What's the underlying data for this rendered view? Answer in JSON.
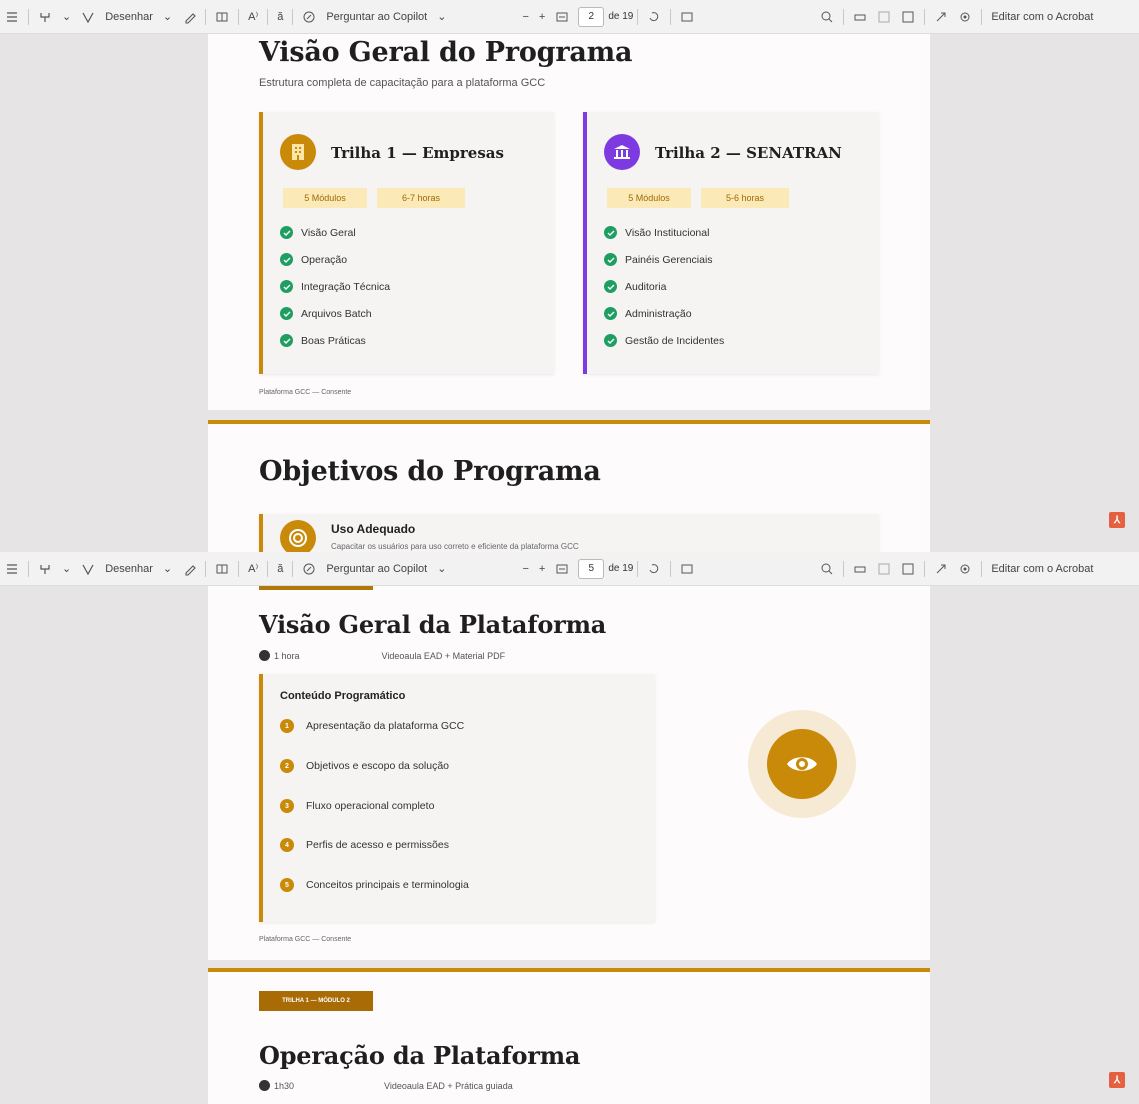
{
  "toolbar": {
    "draw_label": "Desenhar",
    "copilot_label": "Perguntar ao Copilot",
    "read_aloud": "A⁾",
    "translate": "ă",
    "minus": "−",
    "plus": "+",
    "edit_label": "Editar com o Acrobat"
  },
  "panes": [
    {
      "page_number": "2",
      "page_total": "de 19",
      "heading": "Visão Geral do Programa",
      "subtitle": "Estrutura completa de capacitação para a plataforma GCC",
      "tracks": [
        {
          "title": "Trilha 1 — Empresas",
          "color": "#c88a08",
          "icon": "building-icon",
          "modules": "5 Módulos",
          "hours": "6-7 horas",
          "items": [
            "Visão Geral",
            "Operação",
            "Integração Técnica",
            "Arquivos Batch",
            "Boas Práticas"
          ]
        },
        {
          "title": "Trilha 2 — SENATRAN",
          "color": "#7c3ae0",
          "icon": "bank-icon",
          "modules": "5 Módulos",
          "hours": "5-6 horas",
          "items": [
            "Visão Institucional",
            "Painéis Gerenciais",
            "Auditoria",
            "Administração",
            "Gestão de Incidentes"
          ]
        }
      ],
      "footer": "Plataforma GCC — Consente",
      "next_heading": "Objetivos do Programa",
      "next_card_title": "Uso Adequado",
      "next_card_text": "Capacitar os usuários para uso correto e eficiente da plataforma GCC"
    },
    {
      "page_number": "5",
      "page_total": "de 19",
      "heading": "Visão Geral da Plataforma",
      "duration": "1 hora",
      "format": "Videoaula EAD + Material PDF",
      "content_title": "Conteúdo Programático",
      "content_items": [
        {
          "n": "1",
          "text": "Apresentação da plataforma GCC"
        },
        {
          "n": "2",
          "text": "Objetivos e escopo da solução"
        },
        {
          "n": "3",
          "text": "Fluxo operacional completo"
        },
        {
          "n": "4",
          "text": "Perfis de acesso e permissões"
        },
        {
          "n": "5",
          "text": "Conceitos principais e terminologia"
        }
      ],
      "footer": "Plataforma GCC — Consente",
      "badge": "TRILHA 1 — MÓDULO 2",
      "next_heading": "Operação da Plataforma",
      "next_duration": "1h30",
      "next_format": "Videoaula EAD + Prática guiada"
    }
  ],
  "colors": {
    "gold": "#c88a08",
    "purple": "#7c3ae0",
    "green": "#1f9e62",
    "pill_bg": "#fbe9b7"
  }
}
